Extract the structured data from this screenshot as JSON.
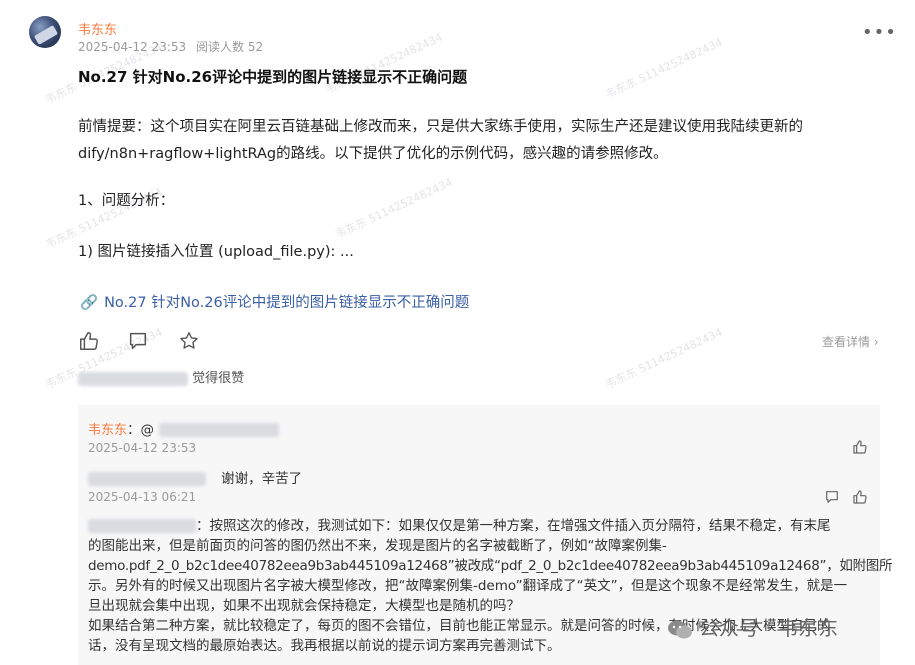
{
  "post": {
    "author": "韦东东",
    "date": "2025-04-12 23:53",
    "reads_label": "阅读人数",
    "reads": "52",
    "title": "No.27 针对No.26评论中提到的图片链接显示不正确问题",
    "paragraphs": [
      "前情提要：这个项目实在阿里云百链基础上修改而来，只是供大家练手使用，实际生产还是建议使用我陆续更新的",
      "dify/n8n+ragflow+lightRAg的路线。以下提供了优化的示例代码，感兴趣的请参照修改。",
      "1、问题分析：",
      "1) 图片链接插入位置 (upload_file.py): ..."
    ],
    "link_text": "No.27 针对No.26评论中提到的图片链接显示不正确问题",
    "view_detail": "查看详情",
    "likes_suffix": "觉得很赞",
    "icons": {
      "more": "more-icon",
      "like": "thumbs-up-icon",
      "comment": "comment-icon",
      "star": "star-icon",
      "link": "link-icon"
    }
  },
  "comments": [
    {
      "author": "韦东东",
      "prefix": "：@",
      "date": "2025-04-12 23:53",
      "text": ""
    },
    {
      "author": "",
      "prefix": "",
      "date": "2025-04-13 06:21",
      "text": "谢谢，辛苦了"
    },
    {
      "author": "",
      "prefix": "",
      "date": "",
      "text_lines": [
        "：按照这次的修改，我测试如下：如果仅仅是第一种方案，在增强文件插入页分隔符，结果不稳定，有末尾",
        "的图能出来，但是前面页的问答的图仍然出不来，发现是图片的名字被截断了，例如“故障案例集-",
        "demo.pdf_2_0_b2c1dee40782eea9b3ab445109a12468”被改成“pdf_2_0_b2c1dee40782eea9b3ab445109a12468”，如附图所",
        "示。另外有的时候又出现图片名字被大模型修改，把“故障案例集-demo”翻译成了“英文”，但是这个现象不是经常发生，就是一",
        "旦出现就会集中出现，如果不出现就会保持稳定，大模型也是随机的吗？",
        "如果结合第二种方案，就比较稳定了，每页的图不会错位，目前也能正常显示。就是问答的时候，有时候会加上大模型自己的",
        "话，没有呈现文档的最原始表达。我再根据以前说的提示词方案再完善测试下。"
      ]
    }
  ],
  "watermark": "韦东东 5114252482434",
  "brand": "公众号 · 韦东东"
}
